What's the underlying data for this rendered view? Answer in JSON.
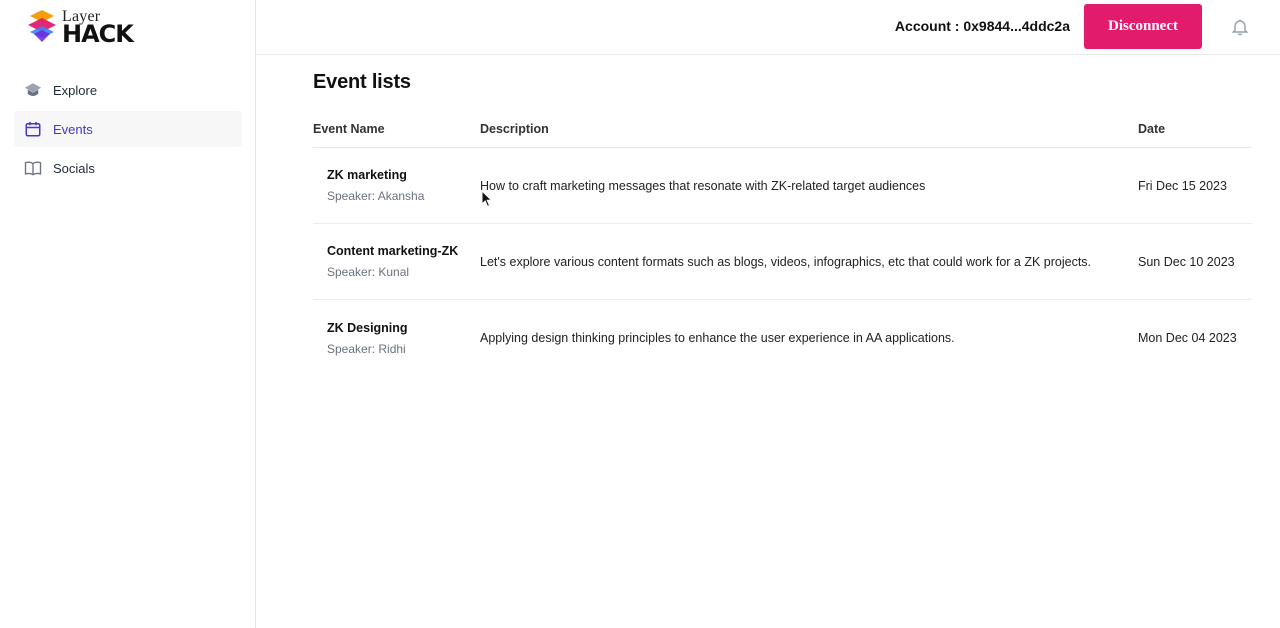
{
  "brand": {
    "name_top": "Layer",
    "name_bottom": "HACK",
    "colors": {
      "orange": "#f59e0b",
      "pink": "#e31b6d",
      "blue": "#3b82f6",
      "purple": "#6d28d9"
    }
  },
  "sidebar": {
    "items": [
      {
        "label": "Explore",
        "icon": "graduation-cap-icon",
        "active": false
      },
      {
        "label": "Events",
        "icon": "calendar-icon",
        "active": true
      },
      {
        "label": "Socials",
        "icon": "book-icon",
        "active": false
      }
    ]
  },
  "header": {
    "account_label": "Account : 0x9844...4ddc2a",
    "disconnect_label": "Disconnect",
    "bell_icon": "bell-icon",
    "accent_color": "#e31b6d"
  },
  "main": {
    "title": "Event lists",
    "columns": {
      "name": "Event Name",
      "description": "Description",
      "date": "Date"
    },
    "events": [
      {
        "name": "ZK marketing",
        "speaker": "Speaker: Akansha",
        "description": "How to craft marketing messages that resonate with ZK-related target audiences",
        "date": "Fri Dec 15 2023"
      },
      {
        "name": "Content marketing-ZK",
        "speaker": "Speaker: Kunal",
        "description": "Let's explore various content formats such as blogs, videos, infographics, etc that could work for a ZK projects.",
        "date": "Sun Dec 10 2023"
      },
      {
        "name": "ZK Designing",
        "speaker": "Speaker: Ridhi",
        "description": "Applying design thinking principles to enhance the user experience in AA applications.",
        "date": "Mon Dec 04 2023"
      }
    ]
  }
}
